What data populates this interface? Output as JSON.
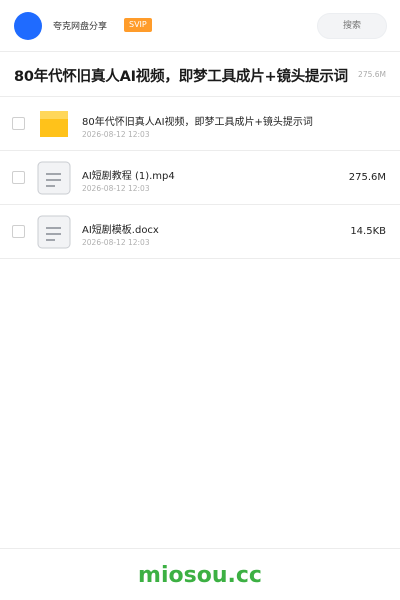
{
  "header": {
    "app_name": "夸克网盘分享",
    "badge": "SVIP",
    "search_placeholder": "搜索"
  },
  "share": {
    "title": "80年代怀旧真人AI视频，即梦工具成片+镜头提示词",
    "total_size": "275.6M"
  },
  "files": [
    {
      "name": "80年代怀旧真人AI视频，即梦工具成片+镜头提示词",
      "date": "2026-08-12 12:03",
      "size": "",
      "icon": "folder-icon"
    },
    {
      "name": "AI短剧教程 (1).mp4",
      "date": "2026-08-12 12:03",
      "size": "275.6M",
      "icon": "video-file-icon"
    },
    {
      "name": "AI短剧模板.docx",
      "date": "2026-08-12 12:03",
      "size": "14.5KB",
      "icon": "document-file-icon"
    }
  ],
  "footer": {
    "brand": "miosou.cc"
  },
  "colors": {
    "avatar": "#1f6bff",
    "badge": "#ff9c2a",
    "folder": "#ffc21a",
    "brand": "#3cb043"
  }
}
